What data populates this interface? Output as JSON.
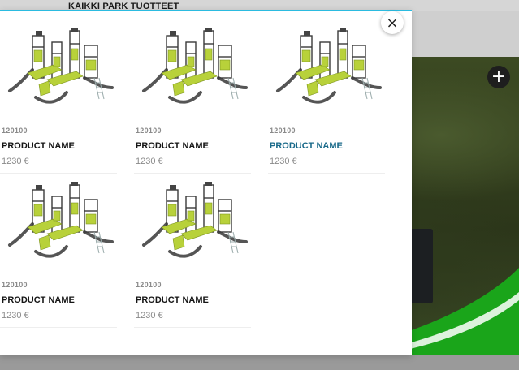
{
  "header": {
    "title": "KAIKKI PARK TUOTTEET"
  },
  "modal": {
    "close_label": "×",
    "products": [
      {
        "sku": "120100",
        "name": "PRODUCT NAME",
        "price": "1230 €",
        "active": false
      },
      {
        "sku": "120100",
        "name": "PRODUCT NAME",
        "price": "1230 €",
        "active": false
      },
      {
        "sku": "120100",
        "name": "PRODUCT NAME",
        "price": "1230 €",
        "active": true
      },
      {
        "sku": "120100",
        "name": "PRODUCT NAME",
        "price": "1230 €",
        "active": false
      },
      {
        "sku": "120100",
        "name": "PRODUCT NAME",
        "price": "1230 €",
        "active": false
      }
    ]
  },
  "background": {
    "plus_label": "+"
  },
  "colors": {
    "accent": "#2bbbe0",
    "active_link": "#1a6a8a",
    "playground_green": "#b8d13a",
    "brand_green": "#1aa51a"
  },
  "icons": {
    "close": "close-icon",
    "expand": "plus-icon"
  }
}
